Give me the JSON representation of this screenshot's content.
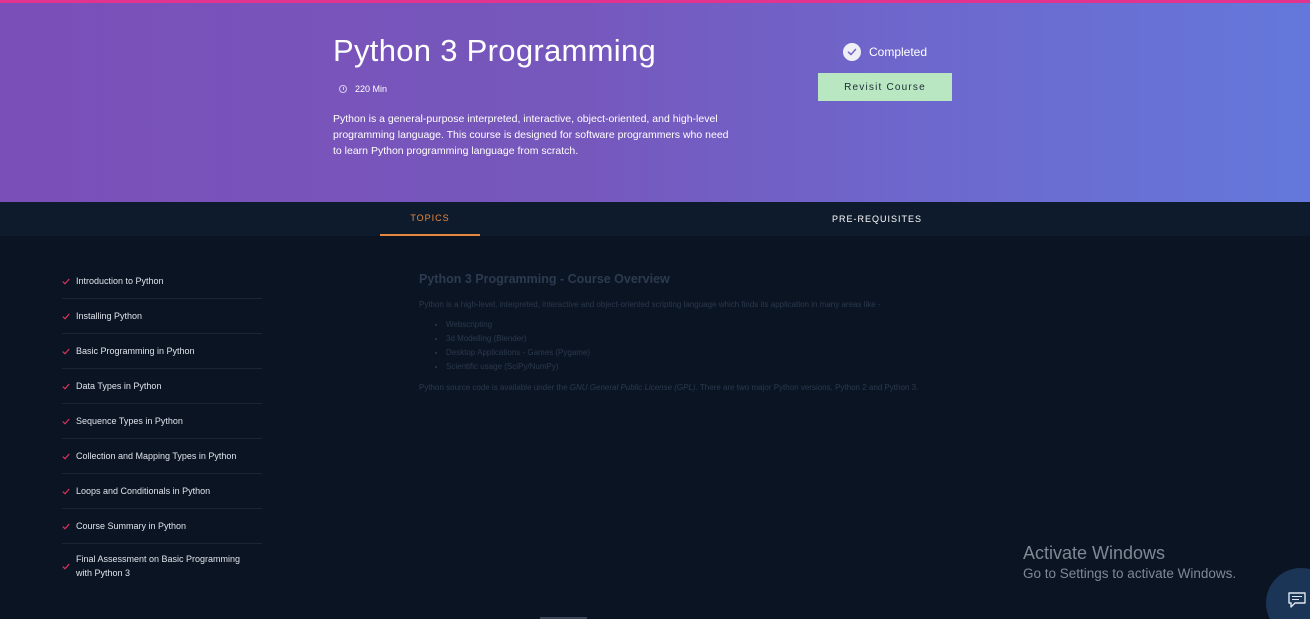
{
  "hero": {
    "title": "Python 3 Programming",
    "duration": "220 Min",
    "description": "Python is a general-purpose interpreted, interactive, object-oriented, and high-level programming language. This course is designed for software programmers who need to learn Python programming language from scratch.",
    "status": "Completed",
    "revisit_label": "Revisit Course"
  },
  "tabs": {
    "topics": "TOPICS",
    "prerequisites": "PRE-REQUISITES"
  },
  "topics": [
    "Introduction to Python",
    "Installing Python",
    "Basic Programming in Python",
    "Data Types in Python",
    "Sequence Types in Python",
    "Collection and Mapping Types in Python",
    "Loops and Conditionals in Python",
    "Course Summary in Python",
    "Final Assessment on Basic Programming with Python 3"
  ],
  "content": {
    "title": "Python 3 Programming - Course Overview",
    "intro": "Python is a high-level, interpreted, interactive and object-oriented scripting language which finds its application in many areas like -",
    "list": [
      "Webscripting",
      "3d Modelling (Blender)",
      "Desktop Applications - Games (Pygame)",
      "Scientific usage (SciPy/NumPy)"
    ],
    "note_before": "Python source code is available under the ",
    "note_license": "GNU General Public License (GPL)",
    "note_after": ". There are two major Python versions, Python 2 and Python 3."
  },
  "watermark": {
    "title": "Activate Windows",
    "subtitle": "Go to Settings to activate Windows."
  },
  "colors": {
    "accent_orange": "#e8873f",
    "top_bar": "#e2338f",
    "button_green": "#b8e7c2",
    "check_red": "#d9345b"
  }
}
